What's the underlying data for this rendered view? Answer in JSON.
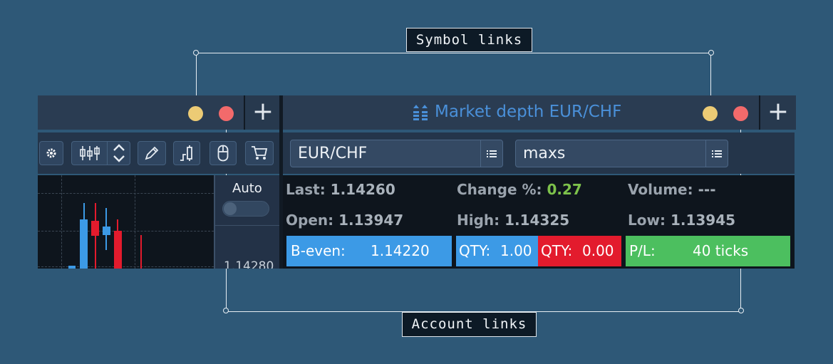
{
  "annotations": {
    "symbol_links_label": "Symbol links",
    "account_links_label": "Account links"
  },
  "colors": {
    "symbol_link": "#eccb75",
    "account_link": "#f26a6b",
    "accent_blue": "#4a90d9",
    "buy_blue": "#3c9ae6",
    "sell_red": "#e31b2d",
    "profit_green": "#4cbf5f",
    "change_green": "#7dc24b"
  },
  "chart_panel": {
    "toolbar_icons": [
      "gear-icon",
      "candlestick-icon",
      "sort-arrows-icon",
      "pencil-icon",
      "bar-chart-icon",
      "mouse-icon",
      "cart-icon"
    ],
    "auto_label": "Auto",
    "price_label": "1.14280"
  },
  "depth_panel": {
    "title": "Market depth EUR/CHF",
    "title_icon": "market-depth-icon",
    "symbol_value": "EUR/CHF",
    "account_value": "maxs",
    "stats": {
      "last_label": "Last:",
      "last_value": "1.14260",
      "change_label": "Change %:",
      "change_value": "0.27",
      "volume_label": "Volume:",
      "volume_value": "---",
      "open_label": "Open:",
      "open_value": "1.13947",
      "high_label": "High:",
      "high_value": "1.14325",
      "low_label": "Low:",
      "low_value": "1.13945"
    },
    "tiles": {
      "beven_label": "B-even:",
      "beven_value": "1.14220",
      "buy_qty_label": "QTY:",
      "buy_qty_value": "1.00",
      "sell_qty_label": "QTY:",
      "sell_qty_value": "0.00",
      "pl_label": "P/L:",
      "pl_value": "40 ticks"
    }
  }
}
